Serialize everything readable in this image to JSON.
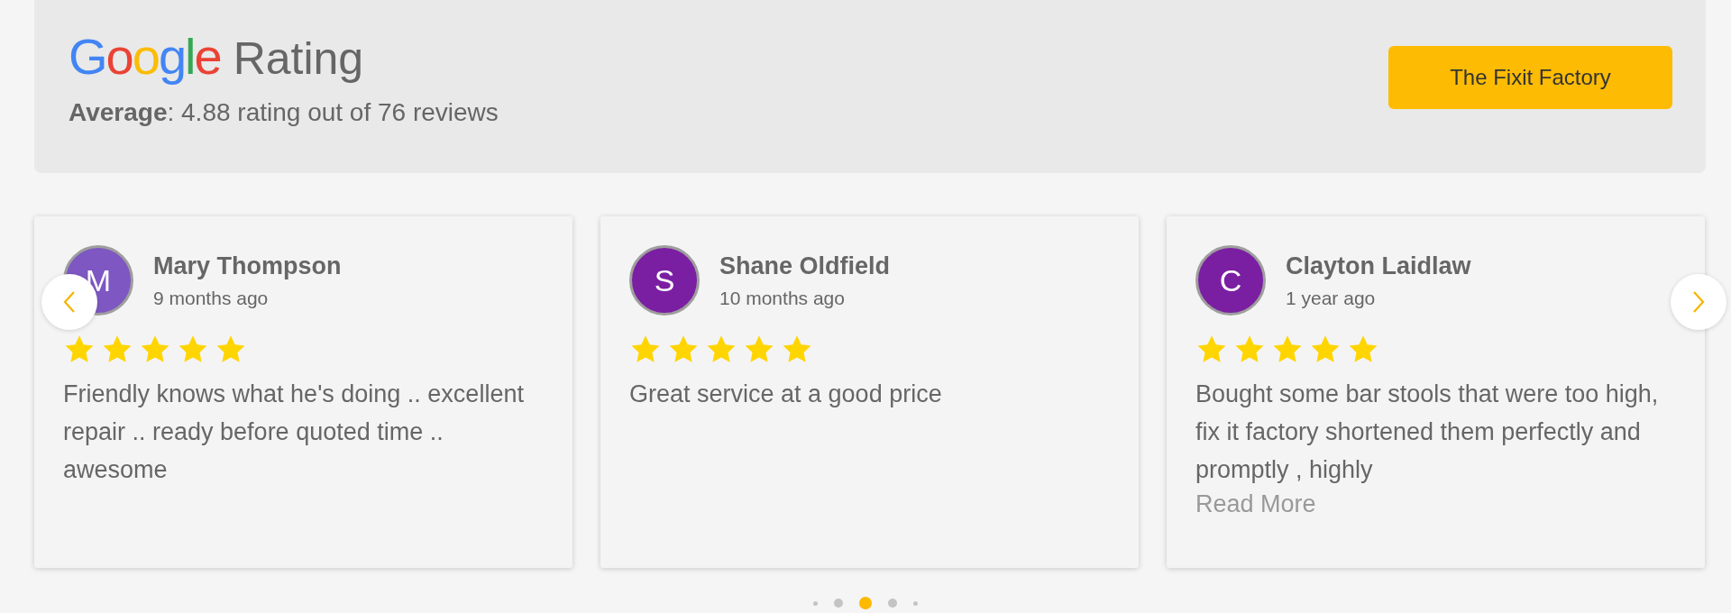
{
  "header": {
    "logo": "Google",
    "title": "Rating",
    "average_label": "Average",
    "average_text": ": 4.88 rating out of 76 reviews",
    "button": "The Fixit Factory"
  },
  "reviews": [
    {
      "initial": "M",
      "color": "#7e57c2",
      "name": "Mary Thompson",
      "time": "9 months ago",
      "stars": 5,
      "text": "Friendly knows what he's doing .. excellent repair .. ready before quoted time .. awesome"
    },
    {
      "initial": "S",
      "color": "#7b1fa2",
      "name": "Shane Oldfield",
      "time": "10 months ago",
      "stars": 5,
      "text": "Great service at a good price"
    },
    {
      "initial": "C",
      "color": "#7b1fa2",
      "name": "Clayton Laidlaw",
      "time": "1 year ago",
      "stars": 5,
      "text": "Bought some bar stools that were too high, fix it factory shortened them perfectly and promptly , highly",
      "read_more": "Read More"
    }
  ],
  "dots": [
    {
      "selected": false
    },
    {
      "selected": false
    },
    {
      "selected": true
    },
    {
      "selected": false
    },
    {
      "selected": false
    }
  ]
}
